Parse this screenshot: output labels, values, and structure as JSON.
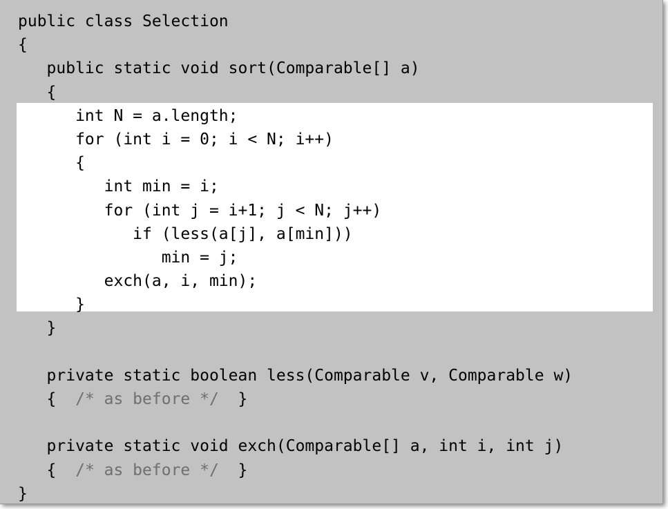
{
  "code": {
    "lines": [
      "public class Selection",
      "{",
      "   public static void sort(Comparable[] a)",
      "   {",
      "      int N = a.length;",
      "      for (int i = 0; i < N; i++)",
      "      {",
      "         int min = i;",
      "         for (int j = i+1; j < N; j++)",
      "            if (less(a[j], a[min]))",
      "               min = j;",
      "         exch(a, i, min);",
      "      }",
      "   }",
      "",
      "   private static boolean less(Comparable v, Comparable w)",
      "   {  ",
      "/* as before */",
      "  }",
      "",
      "   private static void exch(Comparable[] a, int i, int j)",
      "   {  ",
      "/* as before */",
      "  }",
      "}"
    ]
  },
  "colors": {
    "panel_background": "#c2c2c2",
    "highlight_background": "#ffffff",
    "code_text": "#000000",
    "comment_text": "#6f6f6f"
  }
}
